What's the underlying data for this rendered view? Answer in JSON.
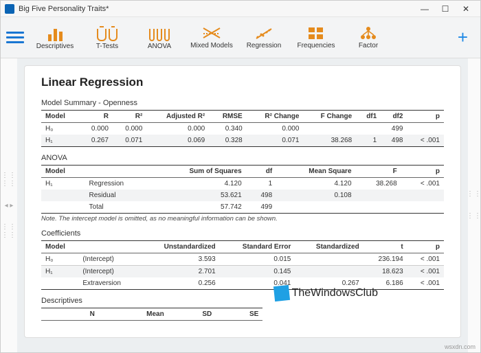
{
  "window": {
    "title": "Big Five Personality Traits*"
  },
  "toolbar": {
    "items": [
      {
        "label": "Descriptives"
      },
      {
        "label": "T-Tests"
      },
      {
        "label": "ANOVA"
      },
      {
        "label": "Mixed Models"
      },
      {
        "label": "Regression"
      },
      {
        "label": "Frequencies"
      },
      {
        "label": "Factor"
      }
    ]
  },
  "page_title": "Linear Regression",
  "model_summary": {
    "title": "Model Summary - Openness",
    "headers": [
      "Model",
      "R",
      "R²",
      "Adjusted R²",
      "RMSE",
      "R² Change",
      "F Change",
      "df1",
      "df2",
      "p"
    ],
    "rows": [
      {
        "model": "H₀",
        "R": "0.000",
        "R2": "0.000",
        "AdjR2": "0.000",
        "RMSE": "0.340",
        "R2Change": "0.000",
        "FChange": "",
        "df1": "",
        "df2": "499",
        "p": ""
      },
      {
        "model": "H₁",
        "R": "0.267",
        "R2": "0.071",
        "AdjR2": "0.069",
        "RMSE": "0.328",
        "R2Change": "0.071",
        "FChange": "38.268",
        "df1": "1",
        "df2": "498",
        "p": "< .001"
      }
    ]
  },
  "anova": {
    "title": "ANOVA",
    "headers": [
      "Model",
      "",
      "Sum of Squares",
      "df",
      "Mean Square",
      "F",
      "p"
    ],
    "note": "Note. The intercept model is omitted, as no meaningful information can be shown.",
    "rows": [
      {
        "model": "H₁",
        "term": "Regression",
        "ss": "4.120",
        "df": "1",
        "ms": "4.120",
        "F": "38.268",
        "p": "< .001"
      },
      {
        "model": "",
        "term": "Residual",
        "ss": "53.621",
        "df": "498",
        "ms": "0.108",
        "F": "",
        "p": ""
      },
      {
        "model": "",
        "term": "Total",
        "ss": "57.742",
        "df": "499",
        "ms": "",
        "F": "",
        "p": ""
      }
    ]
  },
  "coefficients": {
    "title": "Coefficients",
    "headers": [
      "Model",
      "",
      "Unstandardized",
      "Standard Error",
      "Standardized",
      "t",
      "p"
    ],
    "rows": [
      {
        "model": "H₀",
        "term": "(Intercept)",
        "unstd": "3.593",
        "se": "0.015",
        "std": "",
        "t": "236.194",
        "p": "< .001"
      },
      {
        "model": "H₁",
        "term": "(Intercept)",
        "unstd": "2.701",
        "se": "0.145",
        "std": "",
        "t": "18.623",
        "p": "< .001"
      },
      {
        "model": "",
        "term": "Extraversion",
        "unstd": "0.256",
        "se": "0.041",
        "std": "0.267",
        "t": "6.186",
        "p": "< .001"
      }
    ]
  },
  "descriptives": {
    "title": "Descriptives",
    "headers": [
      "",
      "N",
      "Mean",
      "SD",
      "SE"
    ]
  },
  "watermark": "TheWindowsClub",
  "siteurl": "wsxdn.com"
}
